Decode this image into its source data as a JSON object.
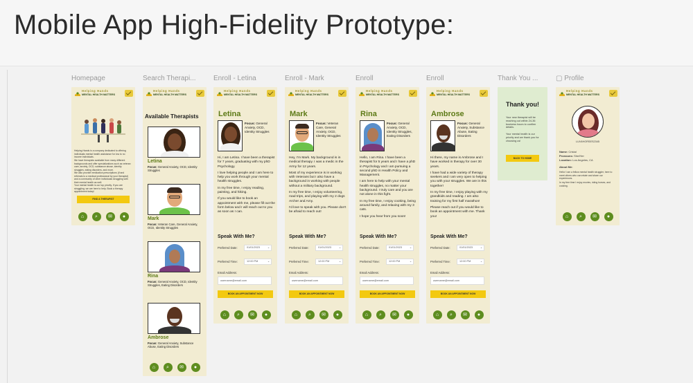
{
  "heading": "Mobile App High-Fidelity Prototype:",
  "brand": {
    "title": "Helping Hands",
    "subtitle": "MENTAL HEALTH MATTERS"
  },
  "frame_labels": [
    "Homepage",
    "Search Therapi...",
    "Enroll - Letina",
    "Enroll - Mark",
    "Enroll",
    "Enroll",
    "Thank You ...",
    "Profile"
  ],
  "homepage": {
    "paragraph_1": "Helping Hands is a company dedicated to offering individuals mental health assistance for low to no income individuals.",
    "paragraph_2": "We have therapists available from many different backgrounds and offer specializations such as veteran care, anxiety, OCD, substance abuse, identity struggles, eating disorders, and more.",
    "paragraph_3": "We also provide medication prescriptions (if and referrals to a medical professional by your therapist) and a community of other individuals struggling with their mental health as well.",
    "paragraph_4": "Your mental health is our top priority. If you are struggling, we are here to help. Book a therapy appointment today!",
    "cta": "FIND A THERAPIST"
  },
  "search": {
    "title": "Available Therapists",
    "therapists": [
      {
        "name": "Letina",
        "focus_label": "Focus:",
        "focus": "General Anxiety, OCD, Identity Struggles"
      },
      {
        "name": "Mark",
        "focus_label": "Focus:",
        "focus": "Veteran Care, General Anxiety, OCD, Identity Struggles"
      },
      {
        "name": "Rina",
        "focus_label": "Focus:",
        "focus": "General Anxiety, OCD, Identity Struggles, Eating Disorders"
      },
      {
        "name": "Ambrose",
        "focus_label": "Focus:",
        "focus": "General Anxiety, Substance Abuse, Eating Disorders"
      }
    ]
  },
  "enroll_common": {
    "speak": "Speak With Me?",
    "date_label": "Preferred Date:",
    "date_value": "01/01/2023",
    "time_label": "Preferred Time:",
    "time_value": "12:00 PM",
    "email_label": "Email Address:",
    "email_value": "username@email.com",
    "cta": "BOOK AN APPOINTMENT NOW"
  },
  "enroll": [
    {
      "name": "Letina",
      "focus_label": "Focus:",
      "focus": "General Anxiety, OCD, Identity Struggles",
      "bio": [
        "Hi, I am Letina. I have been a therapist for 7 years, graduating with my phD Psychology.",
        "I love helping people and I am here to help you work through your mental health struggles.",
        "In my free time, I enjoy reading, painting, and hiking.",
        "If you would like to book an appointment with me, please fill out the form below and I will reach out to you as soon as I can."
      ],
      "cta": "BOOK AN APPOINTMENT NOW"
    },
    {
      "name": "Mark",
      "focus_label": "Focus:",
      "focus": "Veteran Care, General Anxiety, OCD, Identity Struggles",
      "bio": [
        "Hey, I'm Mark. My background is in medical therapy. I was a medic in the Army for 12 years.",
        "Most of my experience is in working with Veterans but I also have a background in working with people without a military background.",
        "In my free time, I enjoy volunteering, road trips, and playing with my 2 dogs Archer and Amy.",
        "I'd love to speak with you. Please don't be afraid to reach out!"
      ],
      "cta": "BOOK AN APPOINTMENT NOW"
    },
    {
      "name": "Rina",
      "focus_label": "Focus:",
      "focus": "General Anxiety, OCD, Identity Struggles, Eating Disorders",
      "bio": [
        "Hello, I am Rina. I have been a therapist for 5 years and I have a phD in Psychology and I am pursuing a second phD in Health Policy and Management.",
        "I am here to help with your mental health struggles, no matter your background. I truly care and you are not alone in this fight.",
        "In my free time, I enjoy cooking, being around family, and relaxing with my 3 cats.",
        "I hope you hear from you soon!"
      ],
      "cta": "BOOK AN APPOINTMENT NOW"
    },
    {
      "name": "Ambrose",
      "focus_label": "Focus:",
      "focus": "General Anxiety, Substance Abuse, Eating Disorders",
      "bio": [
        "Hi there, my name is Ambrose and I have worked in therapy for over 30 years.",
        "I have had a wide variety of therapy seekers and I am very open to helping you with your struggles. We are in this together!",
        "In my free time, I enjoy playing with my grandkids and reading. I am also training for my first half marathon!",
        "Please reach out if you would like to book an appointment with me. Thank you!"
      ],
      "cta": "BOOK AN APPOINTMENT NOW"
    }
  ],
  "thankyou": {
    "title": "Thank you!",
    "text_1": "Your new therapist will be reaching out within 24-36 business hours to confirm details.",
    "text_2": "Your mental health is our priority and we thank you for choosing us!",
    "cta": "BACK TO HOME"
  },
  "profile": {
    "handle": "LUV4HORSES2345",
    "name_label": "Name:",
    "name": "Cristal",
    "pronouns_label": "Pronouns:",
    "pronouns": "She/Her",
    "location_label": "Location:",
    "location": "Los Angeles, CA",
    "about_label": "About Me:",
    "about_1": "Hello! I am a fellow mental health struggler, here to meet others who can relate and share our experiences.",
    "about_2": "In my free time I enjoy movies, riding horses, and cooking."
  },
  "colors": {
    "frame_bg": "#f2ecd2",
    "accent_green": "#5e8d1f",
    "name_green": "#5d7a16",
    "cta_yellow": "#f3c910",
    "thankyou_bg": "#dfecd0"
  },
  "icons": [
    "hands-logo-icon",
    "message-icon",
    "home-icon",
    "search-icon",
    "chat-icon",
    "user-icon",
    "image-frame-icon"
  ]
}
